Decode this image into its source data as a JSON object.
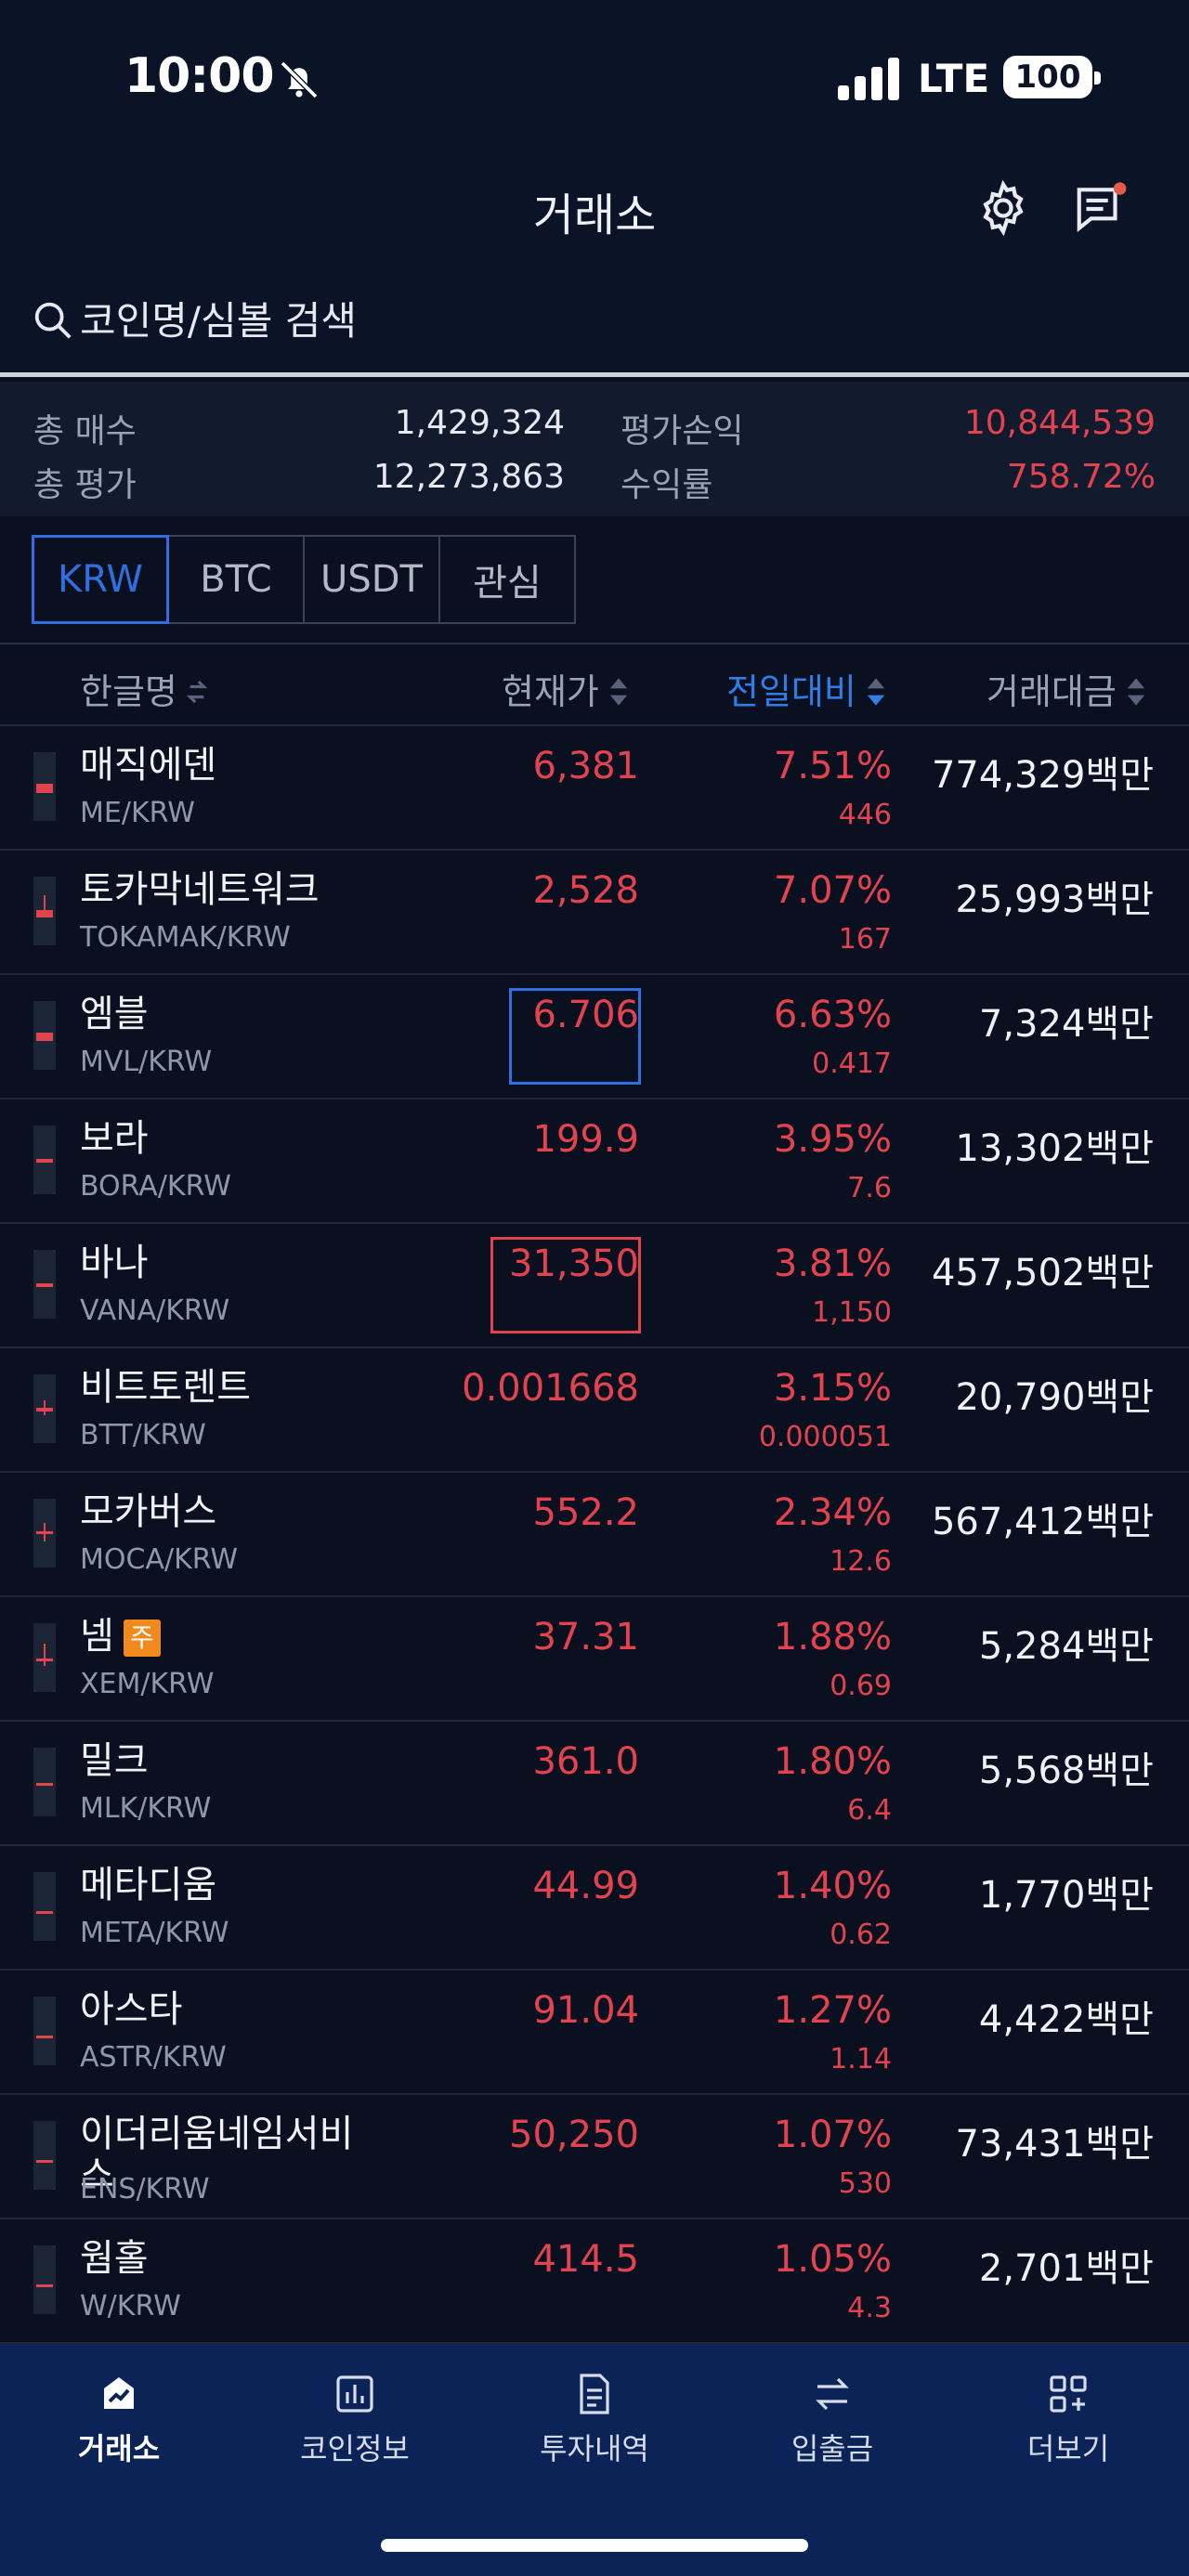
{
  "status": {
    "time": "10:00",
    "network": "LTE",
    "battery": "100"
  },
  "header": {
    "title": "거래소"
  },
  "search": {
    "placeholder": "코인명/심볼 검색"
  },
  "summary": {
    "total_buy_label": "총 매수",
    "total_buy": "1,429,324",
    "total_eval_label": "총 평가",
    "total_eval": "12,273,863",
    "pl_label": "평가손익",
    "pl": "10,844,539",
    "rate_label": "수익률",
    "rate": "758.72%"
  },
  "tabs": [
    "KRW",
    "BTC",
    "USDT",
    "관심"
  ],
  "columns": {
    "name": "한글명",
    "price": "현재가",
    "change": "전일대비",
    "volume": "거래대금"
  },
  "coins": [
    {
      "name": "매직에덴",
      "symbol": "ME/KRW",
      "price": "6,381",
      "pct": "7.51%",
      "chg": "446",
      "vol": "774,329백만"
    },
    {
      "name": "토카막네트워크",
      "symbol": "TOKAMAK/KRW",
      "price": "2,528",
      "pct": "7.07%",
      "chg": "167",
      "vol": "25,993백만"
    },
    {
      "name": "엠블",
      "symbol": "MVL/KRW",
      "price": "6.706",
      "pct": "6.63%",
      "chg": "0.417",
      "vol": "7,324백만"
    },
    {
      "name": "보라",
      "symbol": "BORA/KRW",
      "price": "199.9",
      "pct": "3.95%",
      "chg": "7.6",
      "vol": "13,302백만"
    },
    {
      "name": "바나",
      "symbol": "VANA/KRW",
      "price": "31,350",
      "pct": "3.81%",
      "chg": "1,150",
      "vol": "457,502백만"
    },
    {
      "name": "비트토렌트",
      "symbol": "BTT/KRW",
      "price": "0.001668",
      "pct": "3.15%",
      "chg": "0.000051",
      "vol": "20,790백만"
    },
    {
      "name": "모카버스",
      "symbol": "MOCA/KRW",
      "price": "552.2",
      "pct": "2.34%",
      "chg": "12.6",
      "vol": "567,412백만"
    },
    {
      "name": "넴",
      "badge": "주",
      "symbol": "XEM/KRW",
      "price": "37.31",
      "pct": "1.88%",
      "chg": "0.69",
      "vol": "5,284백만"
    },
    {
      "name": "밀크",
      "symbol": "MLK/KRW",
      "price": "361.0",
      "pct": "1.80%",
      "chg": "6.4",
      "vol": "5,568백만"
    },
    {
      "name": "메타디움",
      "symbol": "META/KRW",
      "price": "44.99",
      "pct": "1.40%",
      "chg": "0.62",
      "vol": "1,770백만"
    },
    {
      "name": "아스타",
      "symbol": "ASTR/KRW",
      "price": "91.04",
      "pct": "1.27%",
      "chg": "1.14",
      "vol": "4,422백만"
    },
    {
      "name": "이더리움네임서비스",
      "symbol": "ENS/KRW",
      "price": "50,250",
      "pct": "1.07%",
      "chg": "530",
      "vol": "73,431백만"
    },
    {
      "name": "웜홀",
      "symbol": "W/KRW",
      "price": "414.5",
      "pct": "1.05%",
      "chg": "4.3",
      "vol": "2,701백만"
    }
  ],
  "nav": [
    "거래소",
    "코인정보",
    "투자내역",
    "입출금",
    "더보기"
  ],
  "colors": {
    "up": "#e3434e",
    "accent": "#2f6fe0",
    "bg": "#0a1020",
    "nav_bg": "#0b2357"
  }
}
